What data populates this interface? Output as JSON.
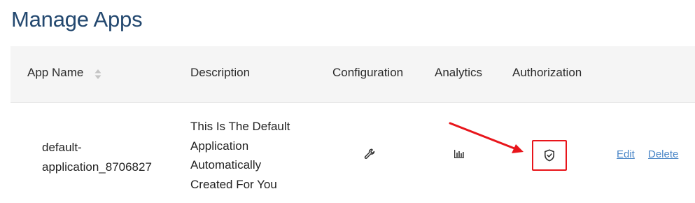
{
  "page": {
    "title": "Manage Apps"
  },
  "table": {
    "columns": {
      "app_name": "App Name",
      "description": "Description",
      "configuration": "Configuration",
      "analytics": "Analytics",
      "authorization": "Authorization"
    },
    "rows": [
      {
        "app_name": "default-application_8706827",
        "app_name_line1": "default-",
        "app_name_line2": "application_8706827",
        "description_lines": [
          "This Is The Default",
          "Application",
          "Automatically",
          "Created For You"
        ],
        "configuration_icon": "wrench-icon",
        "analytics_icon": "bar-chart-icon",
        "authorization_icon": "shield-check-icon",
        "edit_label": "Edit",
        "delete_label": "Delete"
      }
    ]
  },
  "colors": {
    "title": "#23486f",
    "header_bg": "#f5f5f5",
    "link": "#4a86c7",
    "highlight": "#e8151b"
  }
}
